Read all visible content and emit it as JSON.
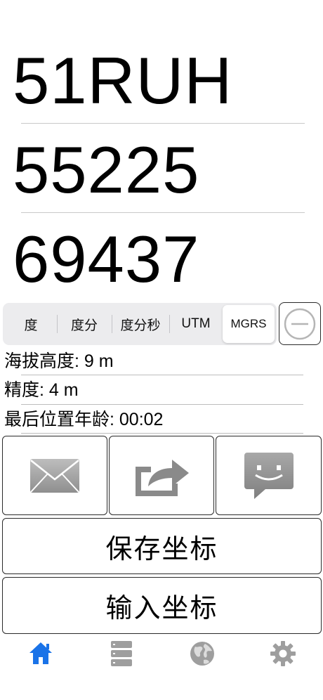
{
  "coordinates": {
    "zone": "51RUH",
    "easting": "55225",
    "northing": "69437"
  },
  "format_selector": {
    "options": [
      "度",
      "度分",
      "度分秒",
      "UTM",
      "MGRS"
    ],
    "selected": "MGRS"
  },
  "info": {
    "altitude": "海拔高度: 9 m",
    "accuracy": "精度: 4 m",
    "last_fix_age": "最后位置年龄: 00:02"
  },
  "buttons": {
    "save_label": "保存坐标",
    "input_label": "输入坐标"
  },
  "icons": {
    "remove": "minus-circle-icon",
    "email": "envelope-icon",
    "share": "share-arrow-icon",
    "message": "chat-bubble-icon",
    "home": "home-icon",
    "list": "stack-list-icon",
    "map": "globe-icon",
    "settings": "gear-icon"
  },
  "colors": {
    "accent": "#1a73e8",
    "inactive_tab": "#9e9e9e",
    "action_icon": "#8a8a8a"
  }
}
